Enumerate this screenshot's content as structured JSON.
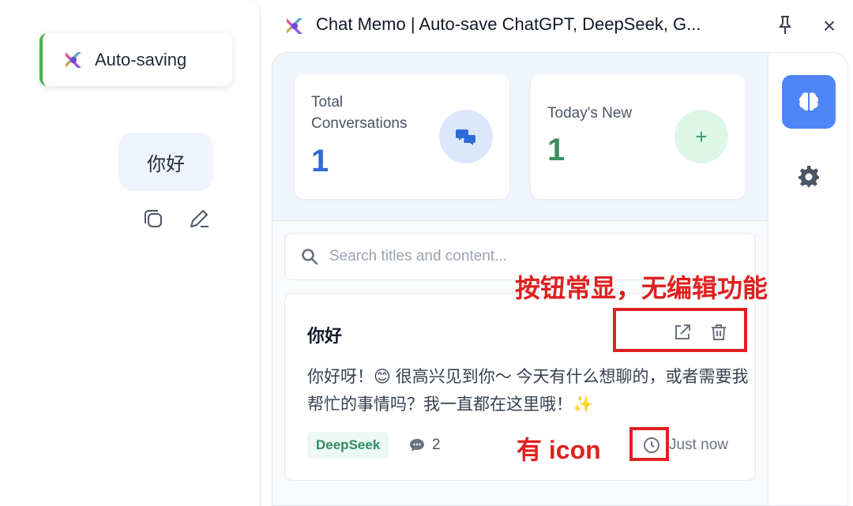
{
  "chat": {
    "toast_text": "Auto-saving",
    "user_message": "你好"
  },
  "popup": {
    "title": "Chat Memo | Auto-save ChatGPT, DeepSeek, G...",
    "close_glyph": "×"
  },
  "stats": {
    "total_label": "Total Conversations",
    "total_value": "1",
    "today_label": "Today's New",
    "today_value": "1",
    "today_icon_glyph": "+"
  },
  "search": {
    "placeholder": "Search titles and content..."
  },
  "conversation": {
    "title": "你好",
    "preview": "你好呀！😊 很高兴见到你～ 今天有什么想聊的，或者需要我帮忙的事情吗？我一直都在这里哦！✨",
    "platform": "DeepSeek",
    "message_count": "2",
    "time": "Just now"
  },
  "annotations": {
    "buttons_note": "按钮常显，无编辑功能",
    "icon_note": "有 icon"
  },
  "colors": {
    "accent_blue": "#4f86f7",
    "total_value_color": "#2f6bd8",
    "today_value_color": "#3f8f5f",
    "annotation_red": "#e02020"
  }
}
